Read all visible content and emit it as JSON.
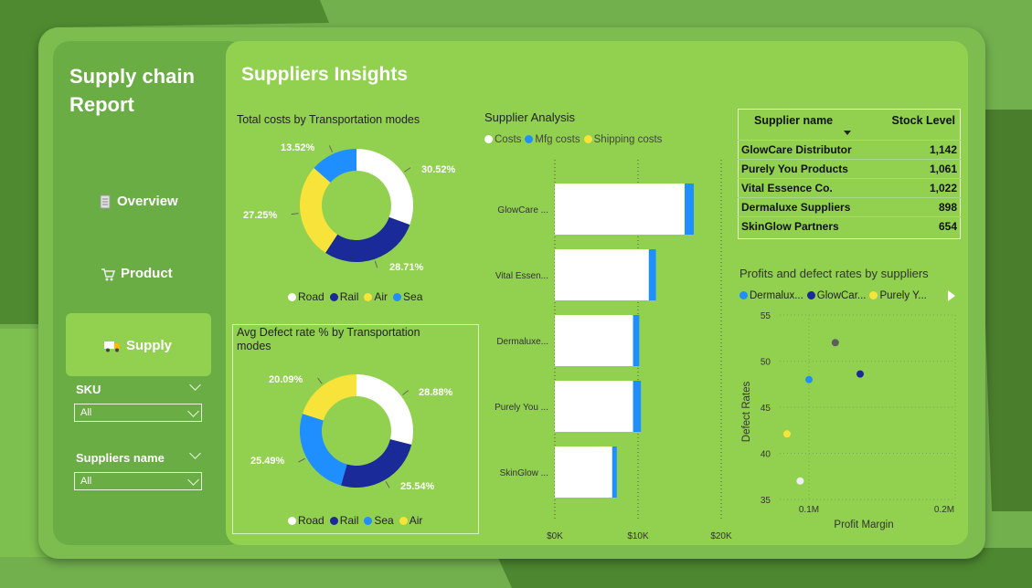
{
  "report": {
    "title": "Supply chain Report"
  },
  "nav": {
    "overview": {
      "label": "Overview",
      "icon": "document-icon"
    },
    "product": {
      "label": "Product",
      "icon": "cart-icon"
    },
    "supply": {
      "label": "Supply",
      "icon": "truck-icon"
    }
  },
  "slicers": {
    "sku": {
      "label": "SKU",
      "value": "All"
    },
    "supplier": {
      "label": "Suppliers name",
      "value": "All"
    }
  },
  "page": {
    "title": "Suppliers Insights"
  },
  "colors": {
    "white": "#ffffff",
    "navy": "#1a2a99",
    "yellow": "#f7e33a",
    "blue": "#1f8eff",
    "grey": "#5e5e5e",
    "lightgrey": "#eeeeee"
  },
  "costs_donut": {
    "title": "Total costs by Transportation modes",
    "chart_data": {
      "type": "pie",
      "categories": [
        "Road",
        "Rail",
        "Air",
        "Sea"
      ],
      "values": [
        30.52,
        28.71,
        27.25,
        13.52
      ],
      "labels": [
        "30.52%",
        "28.71%",
        "27.25%",
        "13.52%"
      ]
    },
    "legend": [
      "Road",
      "Rail",
      "Air",
      "Sea"
    ]
  },
  "defect_donut": {
    "title": "Avg Defect rate % by Transportation modes",
    "chart_data": {
      "type": "pie",
      "categories": [
        "Road",
        "Rail",
        "Sea",
        "Air"
      ],
      "values": [
        28.88,
        25.54,
        25.49,
        20.09
      ],
      "labels": [
        "28.88%",
        "25.54%",
        "25.49%",
        "20.09%"
      ]
    },
    "legend": [
      "Road",
      "Rail",
      "Sea",
      "Air"
    ]
  },
  "supplier_analysis": {
    "title": "Supplier Analysis",
    "legend": [
      "Costs",
      "Mfg costs",
      "Shipping costs"
    ],
    "chart_data": {
      "type": "bar",
      "categories": [
        "GlowCare ...",
        "Vital Essen...",
        "Dermaluxe...",
        "Purely You ...",
        "SkinGlow ..."
      ],
      "series": [
        {
          "name": "Costs",
          "values": [
            0,
            0,
            0,
            0,
            0
          ]
        },
        {
          "name": "Mfg costs",
          "values": [
            15600,
            11300,
            9400,
            9400,
            6900
          ]
        },
        {
          "name": "Shipping costs",
          "values": [
            1100,
            850,
            750,
            950,
            550
          ]
        }
      ],
      "xticks": [
        "$0K",
        "$10K",
        "$20K"
      ],
      "xlim": [
        0,
        20000
      ]
    }
  },
  "supplier_table": {
    "headers": [
      "Supplier name",
      "Stock Level"
    ],
    "rows": [
      [
        "GlowCare Distributor",
        "1,142"
      ],
      [
        "Purely You Products",
        "1,061"
      ],
      [
        "Vital Essence Co.",
        "1,022"
      ],
      [
        "Dermaluxe Suppliers",
        "898"
      ],
      [
        "SkinGlow Partners",
        "654"
      ]
    ]
  },
  "profits_scatter": {
    "title": "Profits and defect rates by suppliers",
    "legend": [
      "Dermalux...",
      "GlowCar...",
      "Purely Y..."
    ],
    "chart_data": {
      "type": "scatter",
      "xlabel": "Profit Margin",
      "ylabel": "Defect Rates",
      "yticks": [
        "55",
        "50",
        "45",
        "40",
        "35"
      ],
      "xticks": [
        "0.1M",
        "0.2M"
      ],
      "ylim": [
        35,
        55
      ],
      "xlim": [
        0.08,
        0.2
      ],
      "points": [
        {
          "x": 0.118,
          "y": 52.0,
          "color": "#5e5e5e"
        },
        {
          "x": 0.1,
          "y": 48.0,
          "color": "#1f8eff"
        },
        {
          "x": 0.135,
          "y": 48.6,
          "color": "#1a2a99"
        },
        {
          "x": 0.085,
          "y": 42.1,
          "color": "#f7e33a"
        },
        {
          "x": 0.094,
          "y": 37.0,
          "color": "#eeeeee"
        }
      ]
    }
  }
}
